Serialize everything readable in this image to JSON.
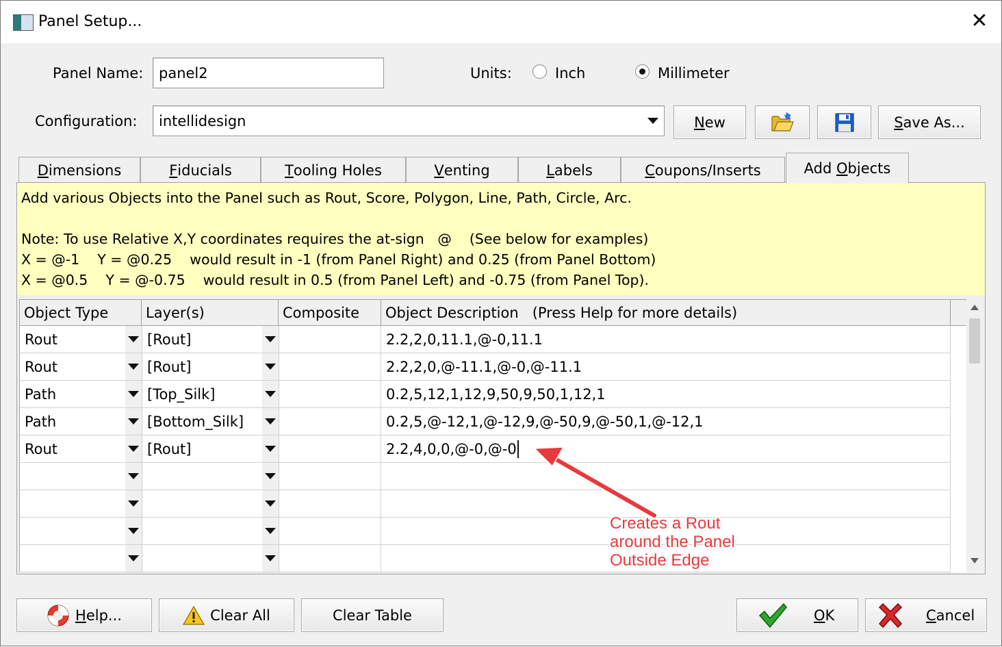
{
  "window": {
    "title": "Panel Setup..."
  },
  "form": {
    "panel_name_label": "Panel Name:",
    "panel_name_value": "panel2",
    "units_label": "Units:",
    "unit_inch": "Inch",
    "unit_mm": "Millimeter",
    "selected_unit": "Millimeter",
    "config_label": "Configuration:",
    "config_value": "intellidesign"
  },
  "toolbar": {
    "new_u": "N",
    "new_rest": "ew",
    "saveas_u": "S",
    "saveas_rest": "ave As..."
  },
  "tabs": [
    {
      "u": "D",
      "rest": "imensions"
    },
    {
      "u": "F",
      "rest": "iducials"
    },
    {
      "u": "T",
      "rest": "ooling Holes"
    },
    {
      "u": "V",
      "rest": "enting"
    },
    {
      "u": "L",
      "rest": "abels"
    },
    {
      "u": "C",
      "rest": "oupons/Inserts"
    },
    {
      "pre": "Add ",
      "u": "O",
      "rest": "bjects"
    }
  ],
  "active_tab": "Add Objects",
  "note": {
    "line1": "Add various Objects into the Panel such as Rout, Score, Polygon, Line, Path, Circle, Arc.",
    "line2": "Note: To use Relative X,Y coordinates requires the at-sign   @    (See below for examples)",
    "line3": "X = @-1    Y = @0.25    would result in -1 (from Panel Right) and 0.25 (from Panel Bottom)",
    "line4": "X = @0.5    Y = @-0.75    would result in 0.5 (from Panel Left) and -0.75 (from Panel Top)."
  },
  "table": {
    "headers": [
      "Object Type",
      "Layer(s)",
      "Composite",
      "Object Description   (Press Help for more details)"
    ],
    "rows": [
      {
        "type": "Rout",
        "layer": "[Rout]",
        "composite": "",
        "desc": "2.2,2,0,11.1,@-0,11.1"
      },
      {
        "type": "Rout",
        "layer": "[Rout]",
        "composite": "",
        "desc": "2.2,2,0,@-11.1,@-0,@-11.1"
      },
      {
        "type": "Path",
        "layer": "[Top_Silk]",
        "composite": "",
        "desc": "0.2,5,12,1,12,9,50,9,50,1,12,1"
      },
      {
        "type": "Path",
        "layer": "[Bottom_Silk]",
        "composite": "",
        "desc": "0.2,5,@-12,1,@-12,9,@-50,9,@-50,1,@-12,1"
      },
      {
        "type": "Rout",
        "layer": "[Rout]",
        "composite": "",
        "desc": "2.2,4,0,0,@-0,@-0"
      },
      {
        "type": "",
        "layer": "",
        "composite": "",
        "desc": ""
      },
      {
        "type": "",
        "layer": "",
        "composite": "",
        "desc": ""
      },
      {
        "type": "",
        "layer": "",
        "composite": "",
        "desc": ""
      },
      {
        "type": "",
        "layer": "",
        "composite": "",
        "desc": ""
      }
    ]
  },
  "annotation": {
    "line1": "Creates a Rout",
    "line2": "around the Panel",
    "line3": "Outside Edge",
    "color": "#e8393e"
  },
  "footer": {
    "help_u": "H",
    "help_rest": "elp...",
    "clear_all": "Clear All",
    "clear_table": "Clear Table",
    "ok_u": "O",
    "ok_rest": "K",
    "cancel_u": "C",
    "cancel_rest": "ancel"
  }
}
